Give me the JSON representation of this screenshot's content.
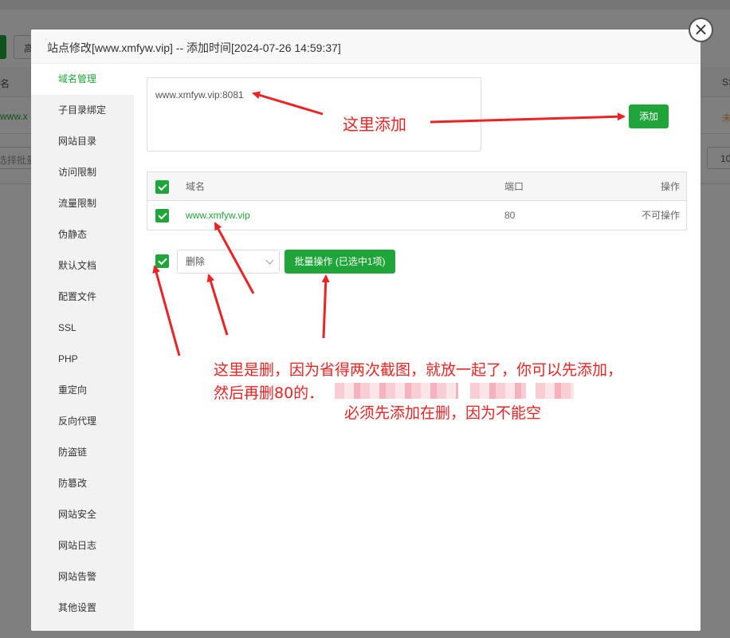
{
  "background": {
    "btn_label": "高",
    "col_header_left": "名",
    "col_header_right": "SS",
    "row_link": "www.x",
    "row_status": "未",
    "batch_placeholder": "选择批量",
    "page_size": "10"
  },
  "modal": {
    "title": "站点修改[www.xmfyw.vip] -- 添加时间[2024-07-26 14:59:37]",
    "close_icon": "close-icon"
  },
  "sidebar": {
    "items": [
      {
        "label": "域名管理",
        "active": true
      },
      {
        "label": "子目录绑定"
      },
      {
        "label": "网站目录"
      },
      {
        "label": "访问限制"
      },
      {
        "label": "流量限制"
      },
      {
        "label": "伪静态"
      },
      {
        "label": "默认文档"
      },
      {
        "label": "配置文件"
      },
      {
        "label": "SSL"
      },
      {
        "label": "PHP"
      },
      {
        "label": "重定向"
      },
      {
        "label": "反向代理"
      },
      {
        "label": "防盗链"
      },
      {
        "label": "防篡改"
      },
      {
        "label": "网站安全"
      },
      {
        "label": "网站日志"
      },
      {
        "label": "网站告警"
      },
      {
        "label": "其他设置"
      }
    ]
  },
  "domain_form": {
    "input_value": "www.xmfyw.vip:8081",
    "add_label": "添加"
  },
  "table": {
    "headers": {
      "name": "域名",
      "port": "端口",
      "action": "操作"
    },
    "rows": [
      {
        "name": "www.xmfyw.vip",
        "port": "80",
        "action": "不可操作"
      }
    ]
  },
  "batch": {
    "select_value": "删除",
    "button_label": "批量操作 (已选中1项)"
  },
  "annotations": {
    "add_note": "这里添加",
    "delete_note_line1": "这里是删，因为省得两次截图，就放一起了，你可以先添加，",
    "delete_note_line2": "然后再删80的．",
    "delete_note_line3": "必须先添加在删，因为不能空"
  },
  "colors": {
    "accent": "#20a53a",
    "annotation": "#ea2424"
  }
}
